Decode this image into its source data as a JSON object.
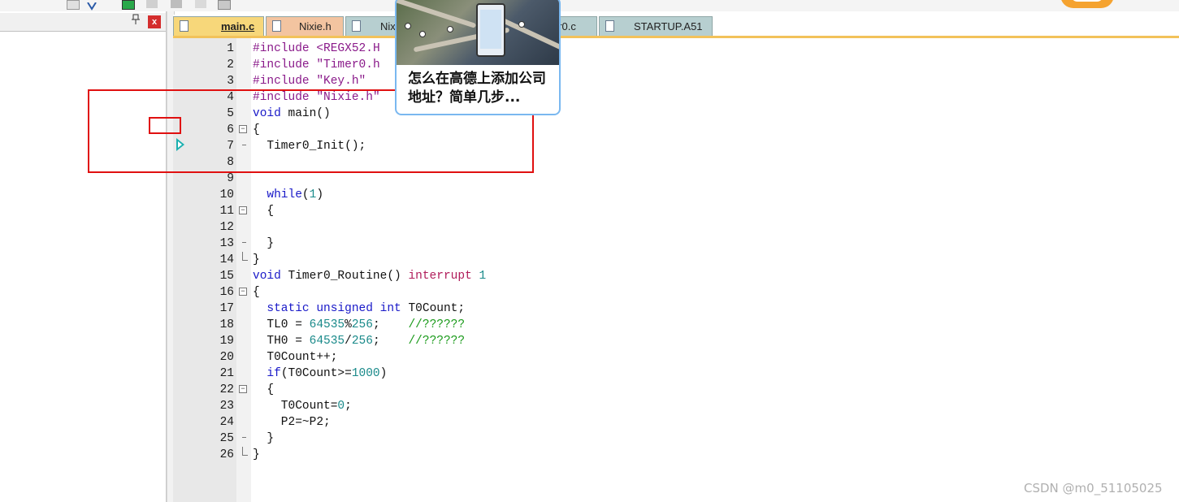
{
  "tabs": [
    {
      "label": "main.c",
      "active": true
    },
    {
      "label": "Nixie.h",
      "active": false
    },
    {
      "label": "Nix",
      "active": false
    },
    {
      "label": "er0.c",
      "active": false
    },
    {
      "label": "STARTUP.A51",
      "active": false
    }
  ],
  "panel": {
    "pin_icon": "pin-icon",
    "close_label": "x"
  },
  "code_lines": [
    {
      "n": "1"
    },
    {
      "n": "2"
    },
    {
      "n": "3"
    },
    {
      "n": "4"
    },
    {
      "n": "5"
    },
    {
      "n": "6"
    },
    {
      "n": "7"
    },
    {
      "n": "8"
    },
    {
      "n": "9"
    },
    {
      "n": "10"
    },
    {
      "n": "11"
    },
    {
      "n": "12"
    },
    {
      "n": "13"
    },
    {
      "n": "14"
    },
    {
      "n": "15"
    },
    {
      "n": "16"
    },
    {
      "n": "17"
    },
    {
      "n": "18"
    },
    {
      "n": "19"
    },
    {
      "n": "20"
    },
    {
      "n": "21"
    },
    {
      "n": "22"
    },
    {
      "n": "23"
    },
    {
      "n": "24"
    },
    {
      "n": "25"
    },
    {
      "n": "26"
    }
  ],
  "code": {
    "l1a": "#include ",
    "l1b": "<REGX52.H",
    "l2a": "#include ",
    "l2b": "\"Timer0.h",
    "l3a": "#include ",
    "l3b": "\"Key.h\"",
    "l4a": "#include ",
    "l4b": "\"Nixie.h\"",
    "l5a": "void",
    "l5b": " main()",
    "l6": "{",
    "l7": "  Timer0_Init();",
    "l10a": "  ",
    "l10b": "while",
    "l10c": "(",
    "l10d": "1",
    "l10e": ")",
    "l11": "  {",
    "l13": "  }",
    "l14": "}",
    "l15a": "void",
    "l15b": " Timer0_Routine() ",
    "l15c": "interrupt",
    "l15d": " ",
    "l15e": "1",
    "l16": "{",
    "l17a": "  ",
    "l17b": "static",
    "l17c": " ",
    "l17d": "unsigned",
    "l17e": " ",
    "l17f": "int",
    "l17g": " T0Count;",
    "l18a": "  TL0 = ",
    "l18b": "64535",
    "l18c": "%",
    "l18d": "256",
    "l18e": ";    ",
    "l18f": "//??????",
    "l19a": "  TH0 = ",
    "l19b": "64535",
    "l19c": "/",
    "l19d": "256",
    "l19e": ";    ",
    "l19f": "//??????",
    "l20": "  T0Count++;",
    "l21a": "  ",
    "l21b": "if",
    "l21c": "(T0Count>=",
    "l21d": "1000",
    "l21e": ")",
    "l22": "  {",
    "l23a": "    T0Count=",
    "l23b": "0",
    "l23c": ";",
    "l24": "    P2=~P2;",
    "l25": "  }",
    "l26": "}"
  },
  "popup": {
    "text": "怎么在高德上添加公司地址？简单几步..."
  },
  "watermark": "CSDN @m0_51105025",
  "colors": {
    "keyword": "#1818c8",
    "preprocessor": "#8a1a8a",
    "number": "#1a8a8a",
    "comment": "#1a9a1a",
    "highlight_box": "#e01010"
  }
}
